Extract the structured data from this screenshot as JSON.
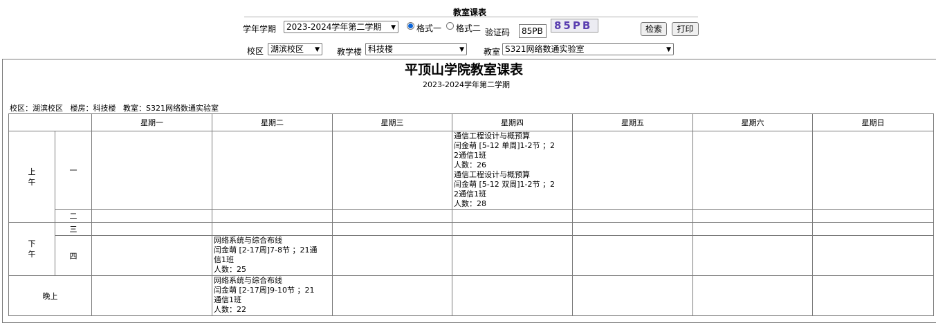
{
  "header": {
    "title": "教室课表",
    "term_label": "学年学期",
    "term_value": "2023-2024学年第二学期",
    "format1_label": "格式一",
    "format2_label": "格式二",
    "captcha_label": "验证码",
    "captcha_input": "85PB",
    "captcha_image_text": "85PB",
    "search_button": "检索",
    "print_button": "打印",
    "campus_label": "校区",
    "campus_value": "湖滨校区",
    "building_label": "教学楼",
    "building_value": "科技楼",
    "room_label": "教室",
    "room_value": "S321网络数通实验室"
  },
  "report": {
    "title": "平顶山学院教室课表",
    "term": "2023-2024学年第二学期",
    "info": "校区：湖滨校区   楼房：科技楼   教室：S321网络数通实验室"
  },
  "table": {
    "days": [
      "星期一",
      "星期二",
      "星期三",
      "星期四",
      "星期五",
      "星期六",
      "星期日"
    ],
    "periods": {
      "morning": "上午",
      "afternoon": "下午",
      "evening": "晚上",
      "p1": "一",
      "p2": "二",
      "p3": "三",
      "p4": "四"
    },
    "thu_p1": {
      "c1_name": "通信工程设计与概预算",
      "c1_detail": "闫金萌 [5-12 单周]1-2节 ；2",
      "c1_class": "2通信1班",
      "c1_count": "人数：26",
      "c2_name": "通信工程设计与概预算",
      "c2_detail": "闫金萌 [5-12 双周]1-2节 ；2",
      "c2_class": "2通信1班",
      "c2_count": "人数：28"
    },
    "tue_p4": {
      "name": "网络系统与综合布线",
      "detail": "闫金萌 [2-17周]7-8节 ；21通",
      "class": "信1班",
      "count": "人数：25"
    },
    "tue_eve": {
      "name": "网络系统与综合布线",
      "detail": "闫金萌 [2-17周]9-10节 ；21",
      "class": "通信1班",
      "count": "人数：22"
    }
  },
  "colors": {
    "border": "#7a7a7a",
    "radio_selected": "#0a64d8"
  }
}
